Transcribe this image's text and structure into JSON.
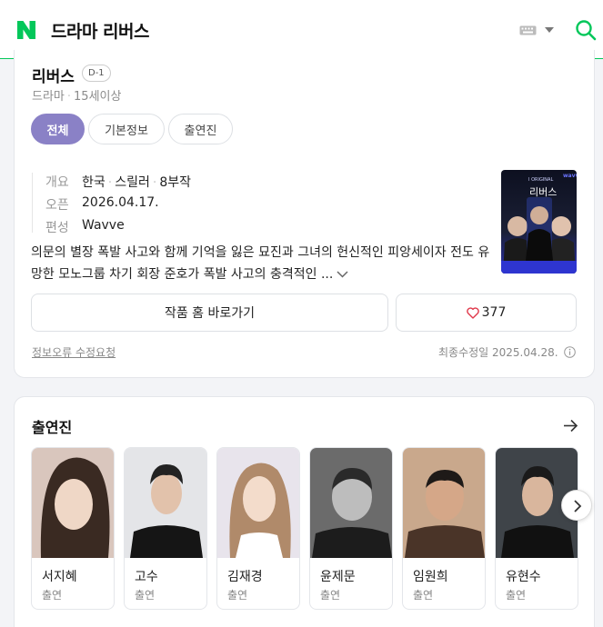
{
  "header": {
    "title": "드라마 리버스",
    "logo_icon": "naver-n-logo",
    "brand_color": "#03c75a"
  },
  "drama": {
    "title": "리버스",
    "dday": "D-1",
    "genre": "드라마",
    "rating": "15세이상",
    "info": {
      "labels": [
        "개요",
        "오픈",
        "편성"
      ],
      "overview": [
        "한국",
        "스릴러",
        "8부작"
      ],
      "open_date": "2026.04.17.",
      "channel": "Wavve"
    },
    "synopsis": "의문의 별장 폭발 사고와 함께 기억을 잃은 묘진과 그녀의 헌신적인 피앙세이자 전도 유망한 모노그룹 차기 회장 준호가 폭발 사고의 충격적인 ...",
    "home_button": "작품 홈 바로가기",
    "likes": "377",
    "report_link": "정보오류 수정요청",
    "updated": "최종수정일 2025.04.28."
  },
  "tabs": [
    {
      "label": "전체",
      "active": true
    },
    {
      "label": "기본정보",
      "active": false
    },
    {
      "label": "출연진",
      "active": false
    }
  ],
  "poster": {
    "top_text": "I ORIGINAL",
    "title": "리버스",
    "badge": "wavve"
  },
  "cast_section": {
    "title": "출연진",
    "members": [
      {
        "name": "서지혜",
        "role": "출연"
      },
      {
        "name": "고수",
        "role": "출연"
      },
      {
        "name": "김재경",
        "role": "출연"
      },
      {
        "name": "윤제문",
        "role": "출연"
      },
      {
        "name": "임원희",
        "role": "출연"
      },
      {
        "name": "유현수",
        "role": "출연"
      }
    ]
  },
  "colors": {
    "accent": "#8a81c6",
    "heart": "#e0384b"
  }
}
